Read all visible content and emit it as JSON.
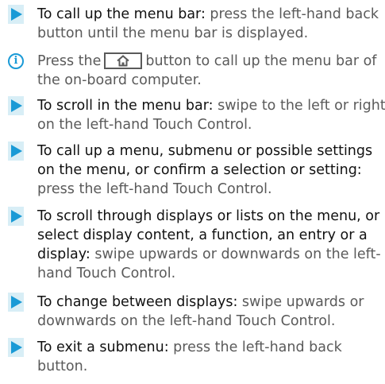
{
  "colors": {
    "accent": "#1a9ad6",
    "marker_bg": "#d8eef6",
    "body_text": "#5a5a5a",
    "lead_text": "#111111"
  },
  "steps": [
    {
      "lead": "To call up the menu bar:",
      "text": "press the left-hand back button until the menu bar is displayed."
    }
  ],
  "note": {
    "icon": "info-icon",
    "icon_glyph": "i",
    "text_before": "Press the",
    "key_icon": "home-icon",
    "text_after": "button to call up the menu bar of the on-board computer."
  },
  "steps_after": [
    {
      "lead": "To scroll in the menu bar:",
      "text": "swipe to the left or right on the left-hand Touch Control."
    },
    {
      "lead": "To call up a menu, submenu or possible set­tings on the menu, or confirm a selection or setting:",
      "text": "press the left-hand Touch Control."
    },
    {
      "lead": "To scroll through displays or lists on the menu, or select display content, a function, an entry or a display:",
      "text": "swipe upwards or down­wards on the left-hand Touch Control."
    },
    {
      "lead": "To change between displays:",
      "text": "swipe upwards or downwards on the left-hand Touch Control."
    },
    {
      "lead": "To exit a submenu:",
      "text": "press the left-hand back button."
    }
  ]
}
